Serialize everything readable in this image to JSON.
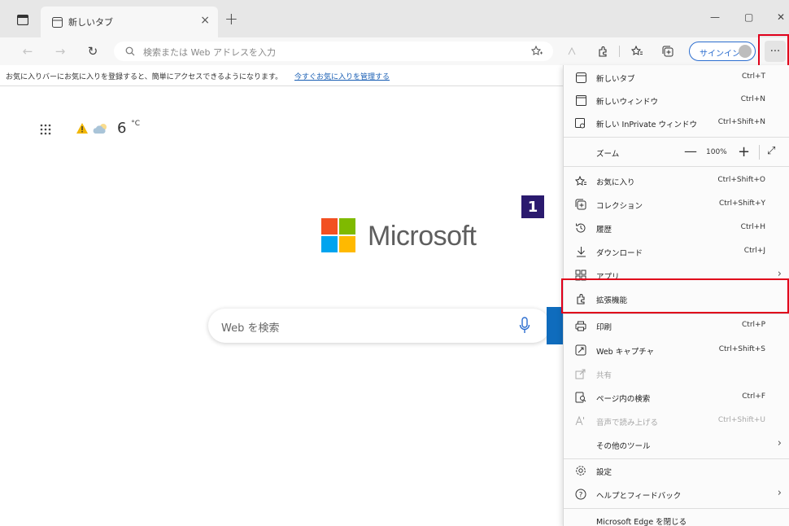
{
  "tab": {
    "title": "新しいタブ",
    "close": "×"
  },
  "window": {
    "new_tab": "+",
    "minimize": "—",
    "maximize": "▢",
    "close": "✕"
  },
  "address": {
    "placeholder": "検索または Web アドレスを入力"
  },
  "toolbar": {
    "signin_label": "サインイン",
    "more": "···"
  },
  "favorites_bar": {
    "message": "お気に入りバーにお気に入りを登録すると、簡単にアクセスできるようになります。",
    "link": "今すぐお気に入りを管理する"
  },
  "newtab": {
    "temperature": "6",
    "temp_unit": "°C",
    "brand": "Microsoft",
    "search_placeholder": "Web を検索"
  },
  "step_badge": "1",
  "menu": {
    "items": [
      {
        "label": "新しいタブ",
        "shortcut": "Ctrl+T",
        "icon": "new-tab-icon"
      },
      {
        "label": "新しいウィンドウ",
        "shortcut": "Ctrl+N",
        "icon": "new-window-icon"
      },
      {
        "label": "新しい InPrivate ウィンドウ",
        "shortcut": "Ctrl+Shift+N",
        "icon": "inprivate-icon"
      }
    ],
    "zoom": {
      "label": "ズーム",
      "minus": "—",
      "value": "100%",
      "plus": "+",
      "fullscreen": "⤢"
    },
    "items2": [
      {
        "label": "お気に入り",
        "shortcut": "Ctrl+Shift+O",
        "icon": "favorites-icon"
      },
      {
        "label": "コレクション",
        "shortcut": "Ctrl+Shift+Y",
        "icon": "collections-icon"
      },
      {
        "label": "履歴",
        "shortcut": "Ctrl+H",
        "icon": "history-icon"
      },
      {
        "label": "ダウンロード",
        "shortcut": "Ctrl+J",
        "icon": "download-icon"
      },
      {
        "label": "アプリ",
        "shortcut": "",
        "icon": "apps-icon",
        "arrow": "›"
      },
      {
        "label": "拡張機能",
        "shortcut": "",
        "icon": "extensions-icon"
      }
    ],
    "items3": [
      {
        "label": "印刷",
        "shortcut": "Ctrl+P",
        "icon": "print-icon"
      },
      {
        "label": "Web キャプチャ",
        "shortcut": "Ctrl+Shift+S",
        "icon": "web-capture-icon"
      },
      {
        "label": "共有",
        "shortcut": "",
        "icon": "share-icon",
        "disabled": true
      },
      {
        "label": "ページ内の検索",
        "shortcut": "Ctrl+F",
        "icon": "find-icon"
      },
      {
        "label": "音声で読み上げる",
        "shortcut": "Ctrl+Shift+U",
        "icon": "read-aloud-icon",
        "disabled": true
      },
      {
        "label": "その他のツール",
        "shortcut": "",
        "icon": "",
        "arrow": "›"
      }
    ],
    "items4": [
      {
        "label": "設定",
        "shortcut": "",
        "icon": "settings-icon"
      },
      {
        "label": "ヘルプとフィードバック",
        "shortcut": "",
        "icon": "help-icon",
        "arrow": "›"
      }
    ],
    "close_edge": "Microsoft Edge を閉じる"
  },
  "colors": {
    "highlight": "#e0001b",
    "badge": "#2a1a6e",
    "ms_red": "#f25022",
    "ms_green": "#7fba00",
    "ms_blue": "#00a4ef",
    "ms_yellow": "#ffb900"
  }
}
